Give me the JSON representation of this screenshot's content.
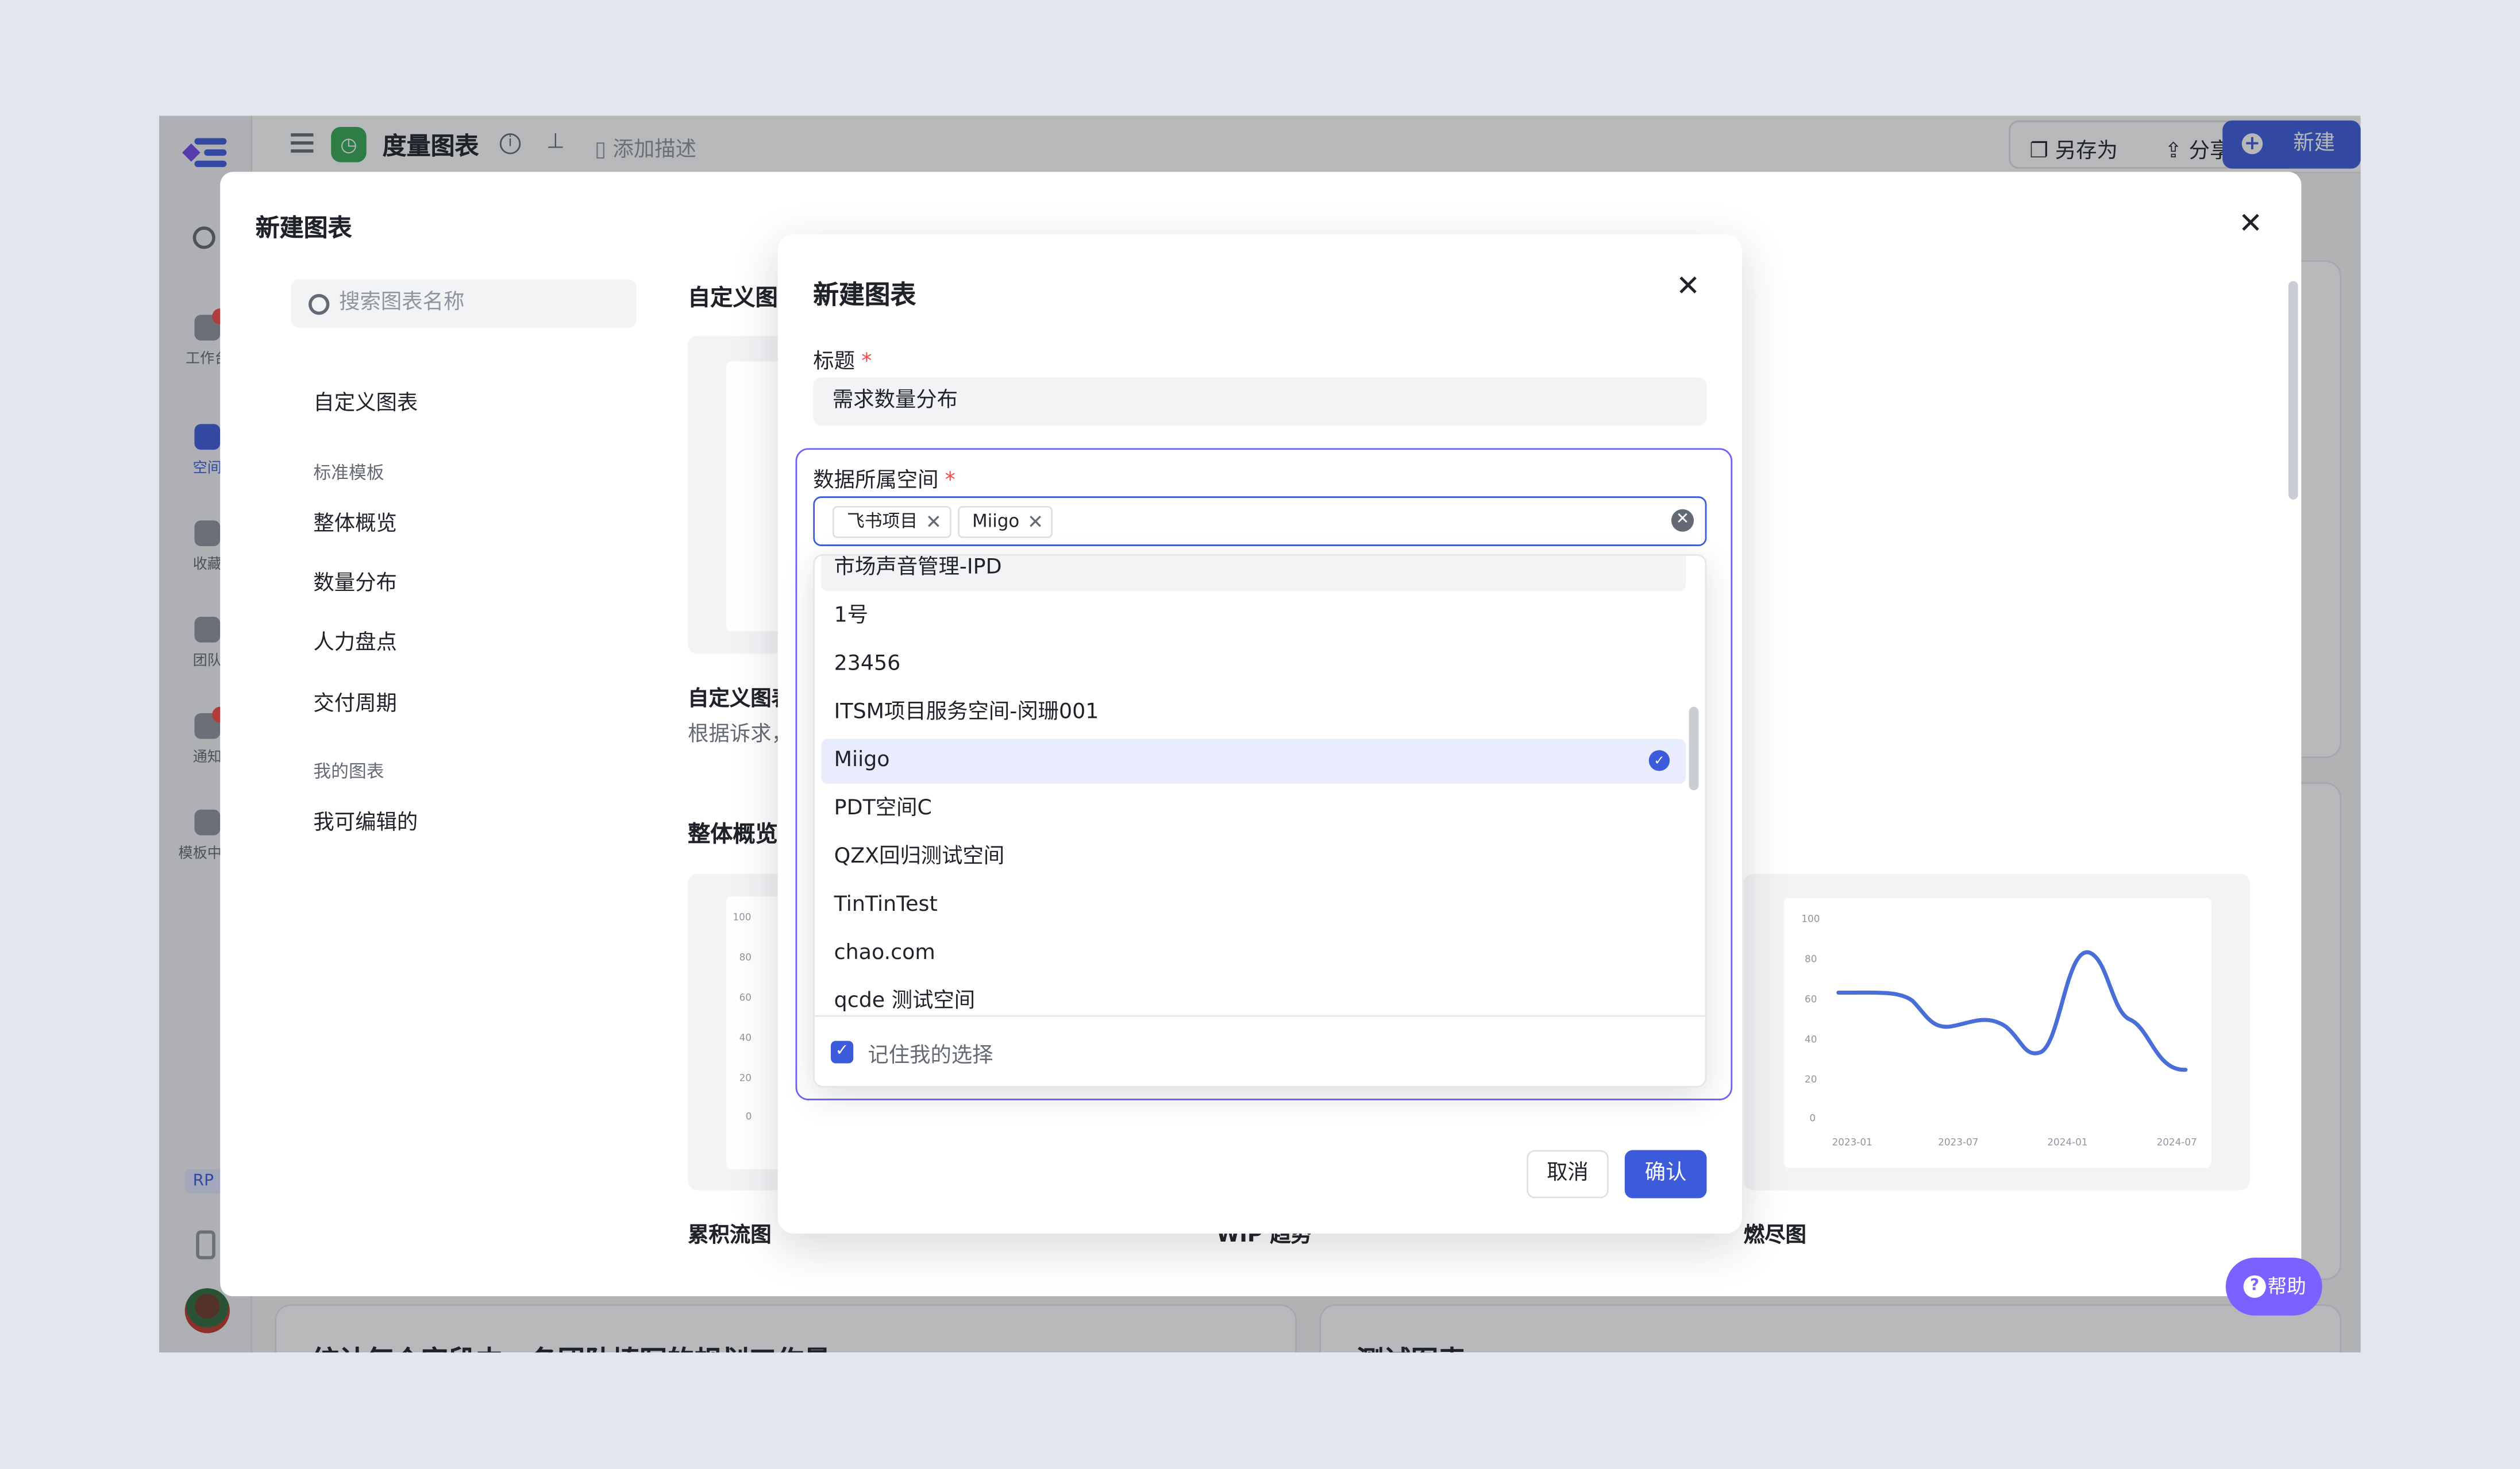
{
  "topbar": {
    "app_icon": "clock-icon",
    "title": "度量图表",
    "add_description": "添加描述",
    "save_as": "另存为",
    "share": "分享",
    "more": "•••",
    "new": "新建"
  },
  "rail": {
    "items": [
      {
        "label": "工作台",
        "icon": "home-icon"
      },
      {
        "label": "空间",
        "icon": "space-icon"
      },
      {
        "label": "收藏",
        "icon": "star-icon"
      },
      {
        "label": "团队",
        "icon": "team-icon"
      },
      {
        "label": "通知",
        "icon": "bell-icon"
      },
      {
        "label": "模板中心",
        "icon": "template-icon"
      }
    ],
    "rp_badge": "RP"
  },
  "background": {
    "card_left_title": "统计每个字段中，各团队填写的规划工作量",
    "card_right_title": "测试图表"
  },
  "help": {
    "label": "帮助"
  },
  "chart_modal": {
    "title": "新建图表",
    "search_placeholder": "搜索图表名称",
    "nav_custom": "自定义图表",
    "group_standard": "标准模板",
    "nav_items": [
      "整体概览",
      "数量分布",
      "人力盘点",
      "交付周期"
    ],
    "group_mine": "我的图表",
    "nav_editable": "我可编辑的",
    "section_custom": "自定义图表",
    "custom_caption": "自定义图表",
    "custom_sub": "根据诉求，",
    "section_overview": "整体概览",
    "captions": [
      "累积流图",
      "WIP 趋势",
      "燃尽图"
    ],
    "y_ticks": [
      "100",
      "80",
      "60",
      "40",
      "20",
      "0"
    ],
    "x_ticks": [
      "2023-01",
      "2023-07",
      "2024-01",
      "2024-07"
    ]
  },
  "dialog": {
    "title": "新建图表",
    "title_label": "标题",
    "title_value": "需求数量分布",
    "space_label": "数据所属空间",
    "required_mark": "*",
    "tags": [
      "飞书项目",
      "Miigo"
    ],
    "options": [
      {
        "label": "市场声音管理-IPD",
        "state": "hover"
      },
      {
        "label": "1号",
        "state": ""
      },
      {
        "label": "23456",
        "state": ""
      },
      {
        "label": "ITSM项目服务空间-闵珊001",
        "state": ""
      },
      {
        "label": "Miigo",
        "state": "selected"
      },
      {
        "label": "PDT空间C",
        "state": ""
      },
      {
        "label": "QZX回归测试空间",
        "state": ""
      },
      {
        "label": "TinTinTest",
        "state": ""
      },
      {
        "label": "chao.com",
        "state": ""
      },
      {
        "label": "qcde 测试空间",
        "state": ""
      }
    ],
    "remember_label": "记住我的选择",
    "remember_checked": true,
    "cancel": "取消",
    "confirm": "确认"
  },
  "colors": {
    "primary": "#3b5bdb",
    "focus_frame": "#6c63ff",
    "help": "#7b61ff",
    "required": "#f54a45"
  }
}
